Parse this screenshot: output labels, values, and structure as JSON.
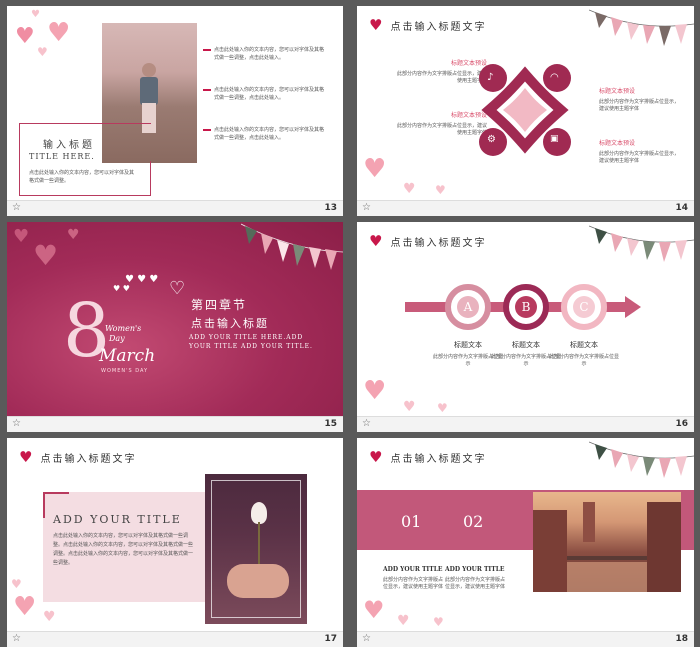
{
  "slides": {
    "s13": {
      "num": "13",
      "title_cn": "输入标题",
      "title_en": "TITLE HERE.",
      "desc": "点击此处输入你的文本内容，您可以对字体及其格式做一些调整。",
      "bullets": [
        "点击此处输入你的文本内容，您可以对字体及其格式做一些调整，点击此处输入。",
        "点击此处输入你的文本内容，您可以对字体及其格式做一些调整，点击此处输入。",
        "点击此处输入你的文本内容，您可以对字体及其格式做一些调整，点击此处输入。"
      ]
    },
    "s14": {
      "num": "14",
      "title": "点击输入标题文字",
      "blocks_left": [
        {
          "head": "标题文本预设",
          "body": "此部分内容作为文字排版占位显示，建议使用主题字体"
        },
        {
          "head": "标题文本预设",
          "body": "此部分内容作为文字排版占位显示，建议使用主题字体"
        }
      ],
      "blocks_right": [
        {
          "head": "标题文本预设",
          "body": "此部分内容作为文字排版占位显示，建议使用主题字体"
        },
        {
          "head": "标题文本预设",
          "body": "此部分内容作为文字排版占位显示，建议使用主题字体"
        }
      ]
    },
    "s15": {
      "num": "15",
      "chapter": "第四章节",
      "subtitle": "点击输入标题",
      "en_line1": "ADD YOUR TITLE HERE.ADD",
      "en_line2": "YOUR TITLE ADD YOUR TITLE.",
      "logo_text1": "Women's",
      "logo_text2": "Day",
      "logo_text3": "March",
      "logo_text4": "WOMEN'S DAY"
    },
    "s16": {
      "num": "16",
      "title": "点击输入标题文字",
      "steps": [
        {
          "letter": "A",
          "head": "标题文本",
          "body": "此部分内容作为文字排版占位显示"
        },
        {
          "letter": "B",
          "head": "标题文本",
          "body": "此部分内容作为文字排版占位显示"
        },
        {
          "letter": "C",
          "head": "标题文本",
          "body": "此部分内容作为文字排版占位显示"
        }
      ]
    },
    "s17": {
      "num": "17",
      "title": "点击输入标题文字",
      "add_title": "ADD YOUR TITLE",
      "body": "点击此处输入你的文本内容，您可以对字体及其格式做一些调整。点击此处输入你的文本内容，您可以对字体及其格式做一些调整。点击此处输入你的文本内容，您可以对字体及其格式做一些调整。"
    },
    "s18": {
      "num": "18",
      "title": "点击输入标题文字",
      "n1": "01",
      "n2": "02",
      "col1_head": "ADD YOUR TITLE",
      "col1_body": "此部分内容作为文字排版占位显示，建议使用主题字体",
      "col2_head": "ADD YOUR TITLE",
      "col2_body": "此部分内容作为文字排版占位显示，建议使用主题字体"
    }
  },
  "colors": {
    "brand": "#c8174a",
    "rose": "#b83a5e",
    "soft": "#e9a7b4"
  }
}
